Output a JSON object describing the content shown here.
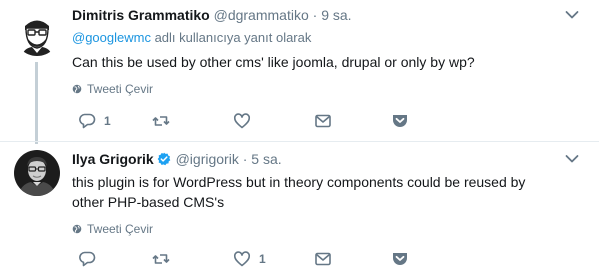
{
  "tweets": [
    {
      "name": "Dimitris Grammatiko",
      "handle": "@dgrammatiko",
      "separator": "·",
      "time": "9 sa.",
      "reply_mention": "@googlewmc",
      "reply_suffix": " adlı kullanıcıya yanıt olarak",
      "text": "Can this be used by other cms' like joomla, drupal or only by wp?",
      "translate_label": "Tweeti Çevir",
      "reply_count": "1",
      "retweet_count": "",
      "like_count": ""
    },
    {
      "name": "Ilya Grigorik",
      "verified": true,
      "handle": "@igrigorik",
      "separator": "·",
      "time": "5 sa.",
      "text": "this plugin is for WordPress but in theory components could be reused by other PHP-based CMS's",
      "translate_label": "Tweeti Çevir",
      "reply_count": "",
      "retweet_count": "",
      "like_count": "1"
    }
  ],
  "colors": {
    "text": "#14171a",
    "secondary": "#657786",
    "link": "#1b95e0",
    "verified": "#1da1f2",
    "thread_line": "#c4cfd6",
    "icon": "#657786"
  },
  "icons": {
    "chevron": "chevron-down-icon",
    "globe": "globe-icon",
    "reply": "reply-icon",
    "retweet": "retweet-icon",
    "like": "heart-icon",
    "dm": "envelope-icon",
    "pocket": "pocket-icon",
    "verified": "verified-badge-icon"
  }
}
